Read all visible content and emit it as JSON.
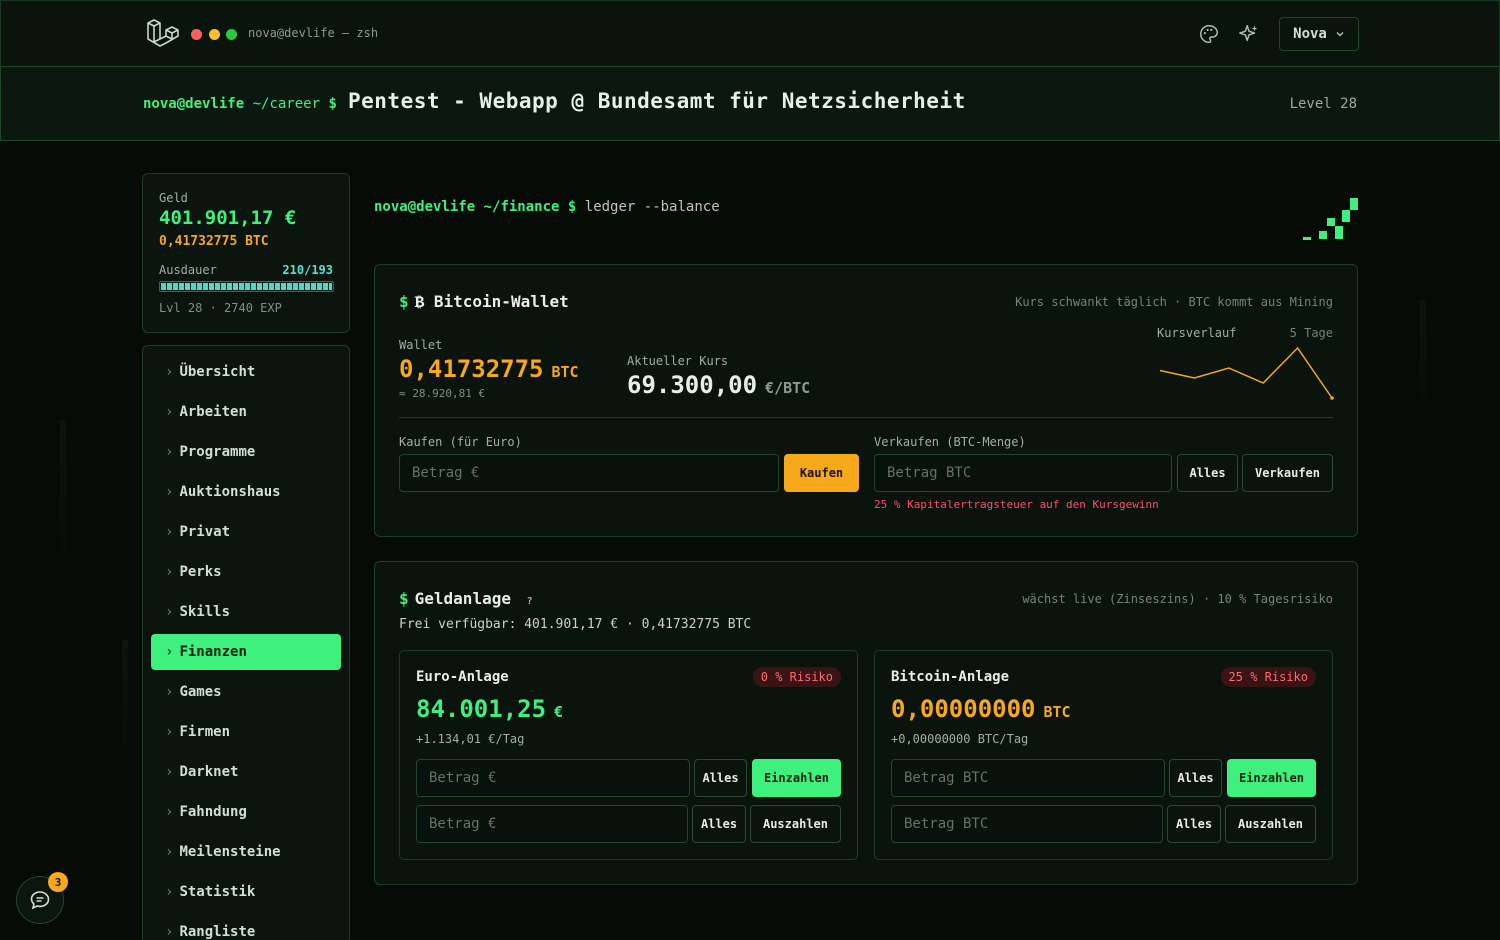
{
  "topbar": {
    "terminal_title": "nova@devlife — zsh",
    "user_button": "Nova"
  },
  "header": {
    "prompt_user": "nova@devlife",
    "prompt_path": "~/career",
    "prompt_symbol": "$",
    "job_title": "Pentest - Webapp @ Bundesamt für Netzsicherheit",
    "level": "Level 28"
  },
  "status": {
    "money_label": "Geld",
    "money": "401.901,17 €",
    "btc": "0,41732775 BTC",
    "stamina_label": "Ausdauer",
    "stamina": "210/193",
    "stamina_fill": 1.0,
    "level_line": "Lvl 28 · 2740 EXP"
  },
  "nav": {
    "items": [
      {
        "label": "Übersicht"
      },
      {
        "label": "Arbeiten"
      },
      {
        "label": "Programme"
      },
      {
        "label": "Auktionshaus"
      },
      {
        "label": "Privat"
      },
      {
        "label": "Perks"
      },
      {
        "label": "Skills"
      },
      {
        "label": "Finanzen"
      },
      {
        "label": "Games"
      },
      {
        "label": "Firmen"
      },
      {
        "label": "Darknet"
      },
      {
        "label": "Fahndung"
      },
      {
        "label": "Meilensteine"
      },
      {
        "label": "Statistik"
      },
      {
        "label": "Rangliste"
      }
    ],
    "active": "Finanzen"
  },
  "chat": {
    "badge": "3"
  },
  "main_prompt": {
    "user": "nova@devlife",
    "path": "~/finance",
    "symbol": "$",
    "command": "ledger --balance"
  },
  "wallet": {
    "symbol": "$",
    "title": "₿ Bitcoin-Wallet",
    "hint": "Kurs schwankt täglich · BTC kommt aus Mining",
    "wallet_label": "Wallet",
    "wallet_value": "0,41732775",
    "wallet_unit": "BTC",
    "wallet_eur": "≈ 28.920,81 €",
    "rate_label": "Aktueller Kurs",
    "rate_value": "69.300,00",
    "rate_unit": "€/BTC",
    "chart_label": "Kursverlauf",
    "chart_range": "5 Tage",
    "buy_label": "Kaufen (für Euro)",
    "buy_placeholder": "Betrag €",
    "buy_button": "Kaufen",
    "sell_label": "Verkaufen (BTC-Menge)",
    "sell_placeholder": "Betrag BTC",
    "sell_all_button": "Alles",
    "sell_button": "Verkaufen",
    "tax_warning": "25 % Kapitalertragsteuer auf den Kursgewinn"
  },
  "chart_data": {
    "type": "line",
    "series": [
      {
        "values": [
          0.55,
          0.4,
          0.6,
          0.3,
          1.0,
          0.0
        ]
      }
    ],
    "color": "#f7a81b"
  },
  "invest": {
    "symbol": "$",
    "title": "Geldanlage",
    "help": "?",
    "hint": "wächst live (Zinseszins) · 10 % Tagesrisiko",
    "available": "Frei verfügbar: 401.901,17 € · 0,41732775 BTC",
    "euro": {
      "title": "Euro-Anlage",
      "risk": "0 % Risiko",
      "value": "84.001,25",
      "unit": "€",
      "per_day": "+1.134,01 €/Tag",
      "deposit_placeholder": "Betrag €",
      "all_label": "Alles",
      "deposit_button": "Einzahlen",
      "withdraw_placeholder": "Betrag €",
      "withdraw_button": "Auszahlen"
    },
    "bitcoin": {
      "title": "Bitcoin-Anlage",
      "risk": "25 % Risiko",
      "value": "0,00000000",
      "unit": "BTC",
      "per_day": "+0,00000000 BTC/Tag",
      "deposit_placeholder": "Betrag BTC",
      "all_label": "Alles",
      "deposit_button": "Einzahlen",
      "withdraw_placeholder": "Betrag BTC",
      "withdraw_button": "Auszahlen"
    }
  },
  "colors": {
    "accent_green": "#3ef07d",
    "accent_orange": "#f7a81b",
    "warning_red": "#ff4f6a"
  }
}
